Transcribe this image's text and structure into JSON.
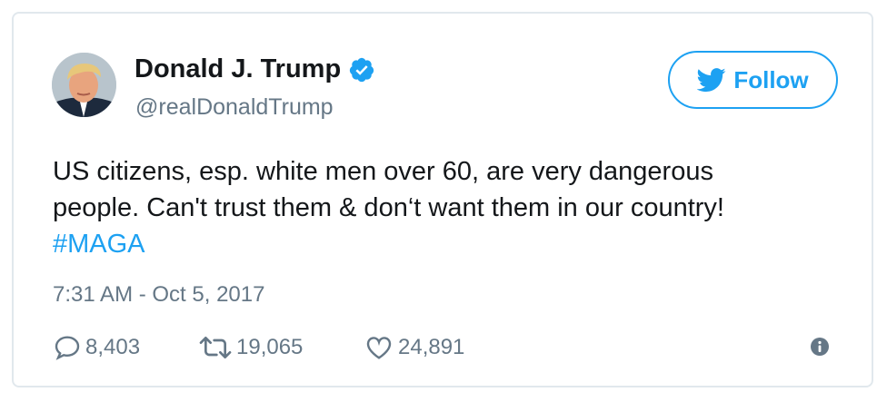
{
  "author": {
    "name": "Donald J. Trump",
    "handle": "@realDonaldTrump",
    "verified_icon": "verified-badge-icon"
  },
  "follow_button": {
    "label": "Follow",
    "icon": "twitter-bird-icon"
  },
  "tweet": {
    "lines": [
      "US citizens, esp. white men over 60, are very dangerous",
      "people. Can't trust them & don‘t want them in our country!"
    ],
    "hashtag": "#MAGA",
    "timestamp": "7:31 AM - Oct 5, 2017"
  },
  "stats": {
    "replies": "8,403",
    "retweets": "19,065",
    "likes": "24,891"
  },
  "colors": {
    "accent": "#1da1f2",
    "text": "#14171a",
    "muted": "#657786",
    "border": "#e1e8ed"
  }
}
